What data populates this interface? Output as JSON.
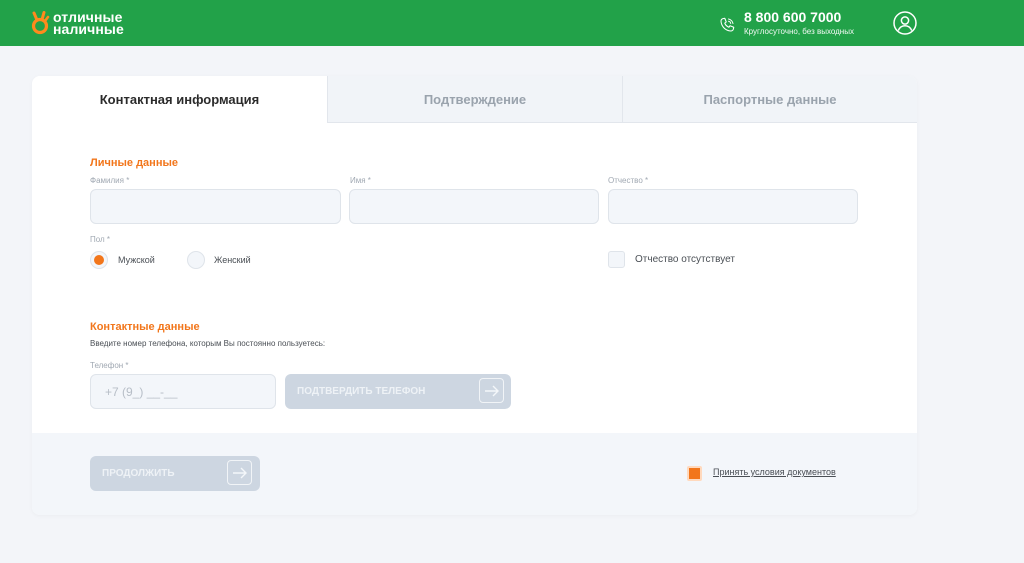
{
  "header": {
    "logo": {
      "line1": "отличные",
      "line2": "наличные"
    },
    "phone": {
      "number": "8 800 600 7000",
      "subtitle": "Круглосуточно, без выходных"
    },
    "colors": {
      "brand_green": "#22a249",
      "accent_orange": "#f2761b"
    }
  },
  "tabs": [
    {
      "label": "Контактная информация",
      "active": true
    },
    {
      "label": "Подтверждение",
      "active": false
    },
    {
      "label": "Паспортные данные",
      "active": false
    }
  ],
  "personal": {
    "title": "Личные данные",
    "surname_label": "Фамилия *",
    "name_label": "Имя *",
    "patronymic_label": "Отчество *",
    "surname_value": "",
    "name_value": "",
    "patronymic_value": "",
    "gender_label": "Пол *",
    "gender_options": [
      {
        "label": "Мужской",
        "checked": true
      },
      {
        "label": "Женский",
        "checked": false
      }
    ],
    "no_patronymic_label": "Отчество отсутствует"
  },
  "contacts": {
    "title": "Контактные данные",
    "hint": "Введите номер телефона, которым Вы постоянно пользуетесь:",
    "phone_label": "Телефон *",
    "phone_placeholder": "+7 (9_) __-__",
    "confirm_button": "ПОДТВЕРДИТЬ ТЕЛЕФОН"
  },
  "footer": {
    "continue_button": "ПРОДОЛЖИТЬ",
    "agree_label": "Принять условия документов",
    "agree_checked": true
  }
}
